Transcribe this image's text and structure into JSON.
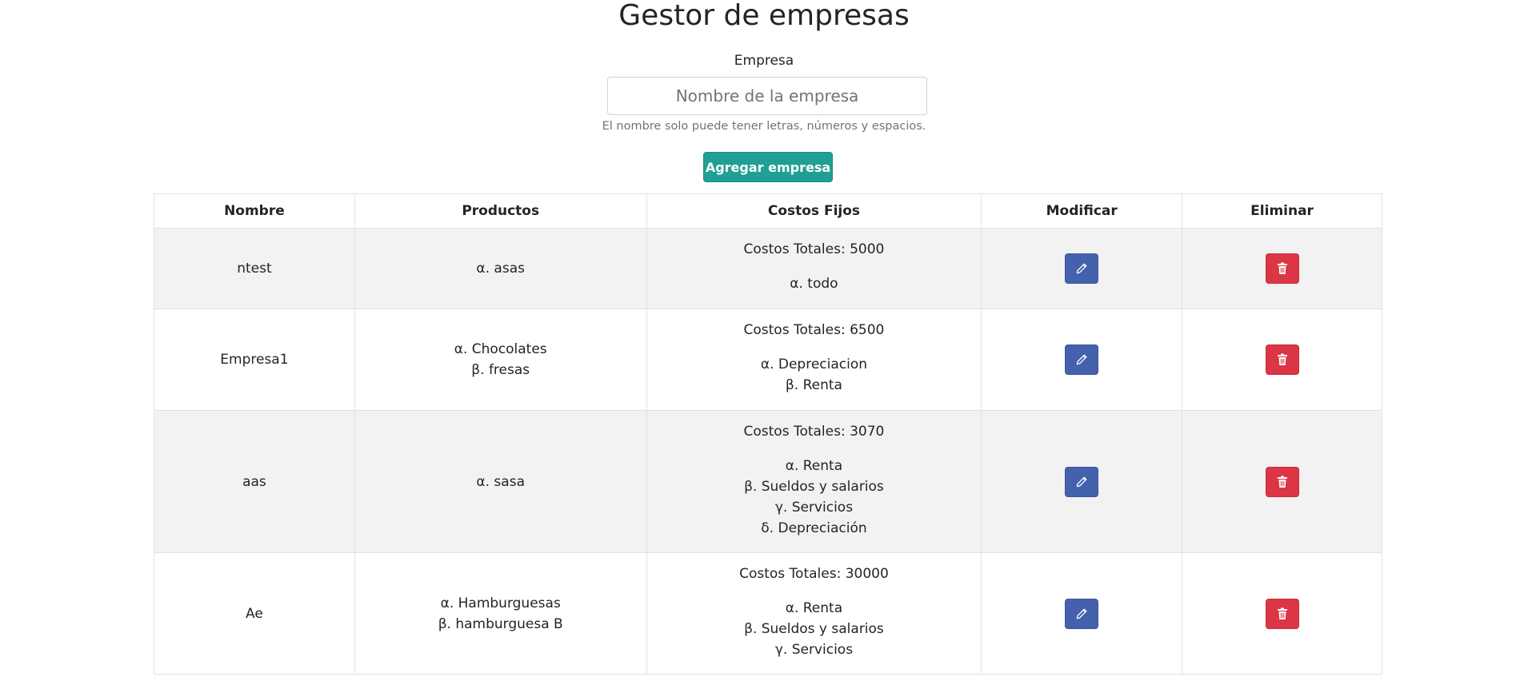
{
  "header": {
    "title": "Gestor de empresas"
  },
  "form": {
    "label": "Empresa",
    "placeholder": "Nombre de la empresa",
    "value": "",
    "help": "El nombre solo puede tener letras, números y espacios.",
    "submit_label": "Agregar empresa"
  },
  "table": {
    "headers": {
      "nombre": "Nombre",
      "productos": "Productos",
      "costos": "Costos Fijos",
      "modificar": "Modificar",
      "eliminar": "Eliminar"
    },
    "rows": [
      {
        "nombre": "ntest",
        "productos": [
          "α. asas"
        ],
        "costos_total": "Costos Totales: 5000",
        "costos": [
          "α. todo"
        ]
      },
      {
        "nombre": "Empresa1",
        "productos": [
          "α. Chocolates",
          "β. fresas"
        ],
        "costos_total": "Costos Totales: 6500",
        "costos": [
          "α. Depreciacion",
          "β. Renta"
        ]
      },
      {
        "nombre": "aas",
        "productos": [
          "α. sasa"
        ],
        "costos_total": "Costos Totales: 3070",
        "costos": [
          "α. Renta",
          "β. Sueldos y salarios",
          "γ. Servicios",
          "δ. Depreciación"
        ]
      },
      {
        "nombre": "Ae",
        "productos": [
          "α. Hamburguesas",
          "β. hamburguesa B"
        ],
        "costos_total": "Costos Totales: 30000",
        "costos": [
          "α. Renta",
          "β. Sueldos y salarios",
          "γ. Servicios"
        ]
      }
    ]
  },
  "icons": {
    "edit": "pencil-icon",
    "delete": "trash-icon"
  },
  "colors": {
    "accent": "#20a095",
    "edit": "#4461ad",
    "delete": "#dc3545",
    "stripe": "#f2f2f2"
  }
}
